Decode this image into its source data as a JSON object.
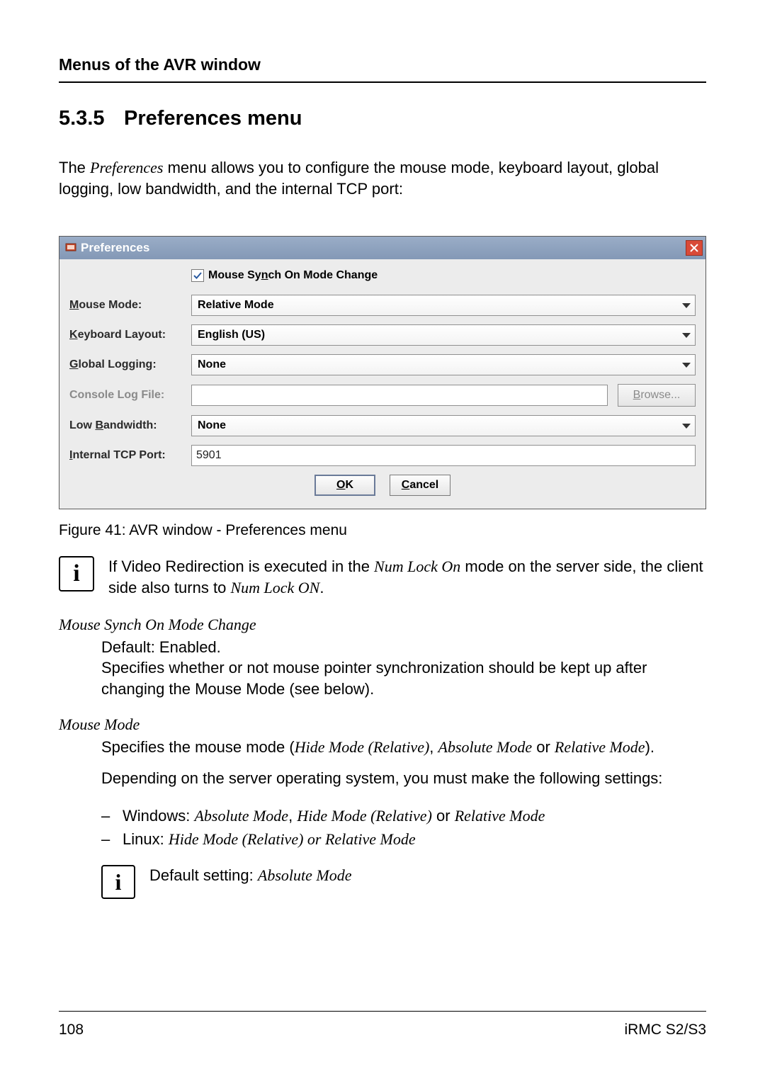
{
  "header": "Menus of the AVR window",
  "section": {
    "number": "5.3.5",
    "title": "Preferences menu"
  },
  "intro": {
    "prefix": "The ",
    "italic": "Preferences",
    "suffix": " menu allows you to configure the mouse mode, keyboard layout, global logging, low bandwidth, and the internal TCP port:"
  },
  "dialog": {
    "title": "Preferences",
    "checkbox": {
      "pre": "Mouse Sy",
      "u": "n",
      "post": "ch On Mode Change"
    },
    "labels": {
      "mouse_mode": {
        "u": "M",
        "post": "ouse Mode:"
      },
      "keyboard": {
        "u": "K",
        "post": "eyboard Layout:"
      },
      "global_logging": {
        "u": "G",
        "post": "lobal Logging:"
      },
      "console_log": {
        "pre": "Console Lo",
        "u": "g",
        "post": " File:"
      },
      "low_bandwidth": {
        "pre": "Low ",
        "u": "B",
        "post": "andwidth:"
      },
      "tcp_port": {
        "u": "I",
        "post": "nternal TCP Port:"
      }
    },
    "values": {
      "mouse_mode": "Relative Mode",
      "keyboard": "English (US)",
      "global_logging": "None",
      "console_log": "",
      "low_bandwidth": "None",
      "tcp_port": "5901"
    },
    "buttons": {
      "browse": {
        "u": "B",
        "post": "rowse..."
      },
      "ok": {
        "u": "O",
        "post": "K"
      },
      "cancel": {
        "u": "C",
        "post": "ancel"
      }
    }
  },
  "figure_caption": "Figure 41: AVR window - Preferences menu",
  "note1": {
    "p1": "If Video Redirection is executed in the ",
    "i1": "Num Lock On",
    "p2": " mode on the server side, the client side also turns to ",
    "i2": "Num Lock ON",
    "p3": "."
  },
  "param1": {
    "heading": "Mouse Synch On Mode Change",
    "body": "Default: Enabled.\nSpecifies whether or not mouse pointer synchronization should be kept up after changing the Mouse Mode (see below)."
  },
  "param2": {
    "heading": "Mouse Mode",
    "body1_p1": "Specifies the mouse mode (",
    "body1_i1": "Hide Mode (Relative)",
    "body1_sep1": ", ",
    "body1_i2": "Absolute Mode",
    "body1_sep2": " or ",
    "body1_i3": "Relative Mode",
    "body1_end": ").",
    "body2": "Depending on the server operating system, you must make the following settings:",
    "bullets": {
      "win": {
        "p1": "Windows: ",
        "i1": "Absolute Mode",
        "s1": ", ",
        "i2": "Hide Mode (Relative)",
        "s2": " or ",
        "i3": "Relative Mode"
      },
      "linux": {
        "p1": "Linux: ",
        "i1": "Hide Mode (Relative) or Relative Mode"
      }
    },
    "default": {
      "p1": "Default setting: ",
      "i1": "Absolute Mode"
    }
  },
  "footer": {
    "page": "108",
    "doc": "iRMC S2/S3"
  }
}
